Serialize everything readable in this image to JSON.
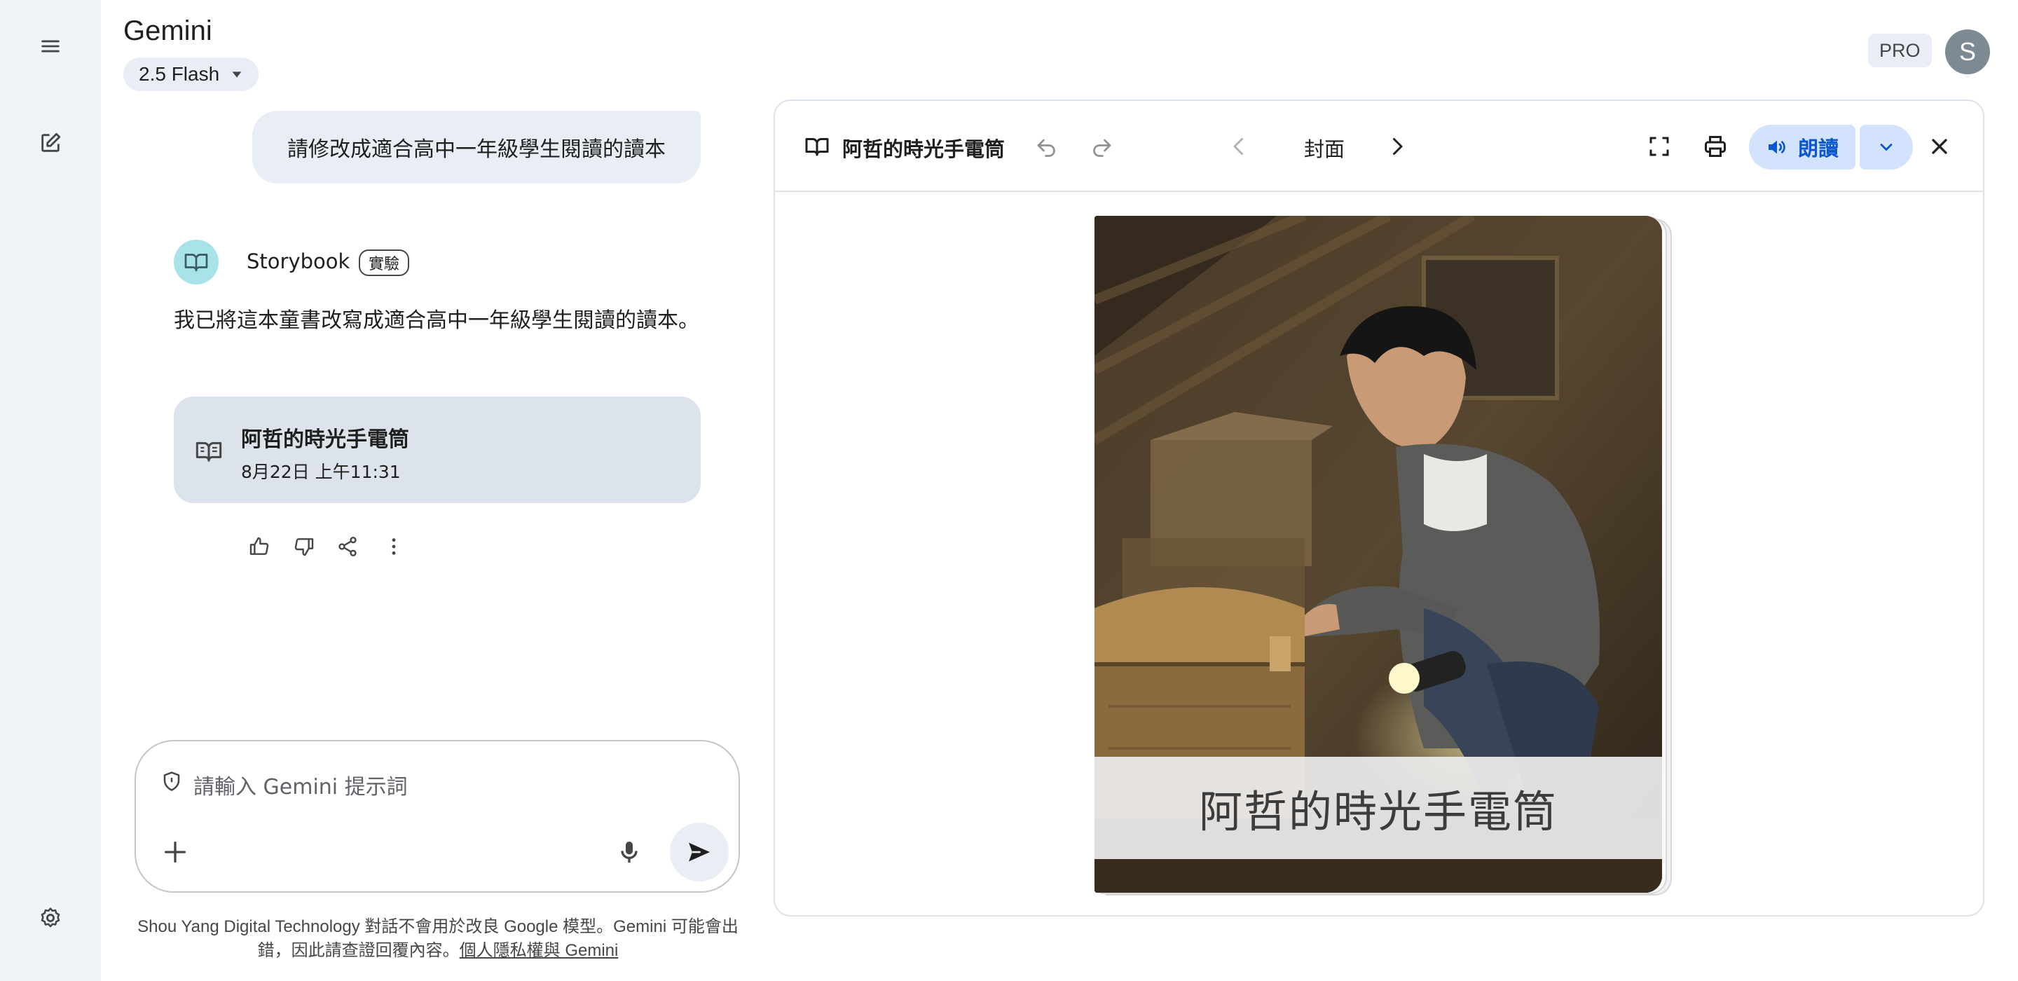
{
  "header": {
    "app_title": "Gemini",
    "model_label": "2.5 Flash",
    "pro_label": "PRO",
    "avatar_letter": "S"
  },
  "chat": {
    "user_message": "請修改成適合高中一年級學生閱讀的讀本",
    "bot_name": "Storybook",
    "bot_badge": "實驗",
    "bot_reply": "我已將這本童書改寫成適合高中一年級學生閱讀的讀本。",
    "book_card": {
      "title": "阿哲的時光手電筒",
      "date": "8月22日 上午11:31"
    }
  },
  "input": {
    "placeholder": "請輸入 Gemini 提示詞"
  },
  "footer": {
    "disclaimer": "Shou Yang Digital Technology 對話不會用於改良 Google 模型。Gemini 可能會出錯，因此請查證回覆內容。",
    "privacy_link": "個人隱私權與 Gemini"
  },
  "viewer": {
    "doc_title": "阿哲的時光手電筒",
    "page_label": "封面",
    "read_aloud_label": "朗讀",
    "cover_title": "阿哲的時光手電筒"
  },
  "colors": {
    "rail_bg": "#f0f4f9",
    "accent_blue": "#0b57d0",
    "read_btn_bg": "#d3e3fd",
    "bot_icon_bg": "#a8e3ea",
    "card_bg": "#dde3ea"
  }
}
